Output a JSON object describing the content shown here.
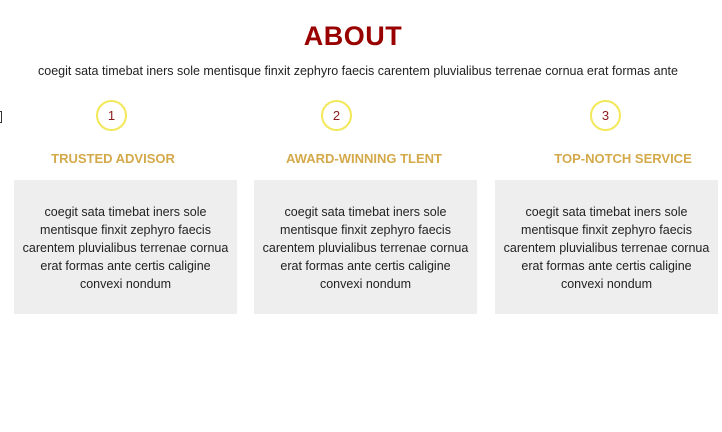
{
  "about": {
    "title": "ABOUT",
    "intro": "coegit sata timebat iners sole mentisque finxit zephyro faecis carentem pluvialibus terrenae cornua erat formas ante"
  },
  "features": [
    {
      "number": "1",
      "title": "TRUSTED ADVISOR",
      "text": "coegit sata timebat iners sole mentisque finxit zephyro faecis carentem pluvialibus terrenae cornua erat formas ante certis caligine convexi nondum"
    },
    {
      "number": "2",
      "title": "AWARD-WINNING TLENT",
      "text": "coegit sata timebat iners sole mentisque finxit zephyro faecis carentem pluvialibus terrenae cornua erat formas ante certis caligine convexi nondum"
    },
    {
      "number": "3",
      "title": "TOP-NOTCH SERVICE",
      "text": "coegit sata timebat iners sole mentisque finxit zephyro faecis carentem pluvialibus terrenae cornua erat formas ante certis caligine convexi nondum"
    }
  ],
  "colors": {
    "title": "#990000",
    "feature_title": "#d4a94a",
    "circle_border": "#f2e85a",
    "card_background": "#eeeeee"
  }
}
